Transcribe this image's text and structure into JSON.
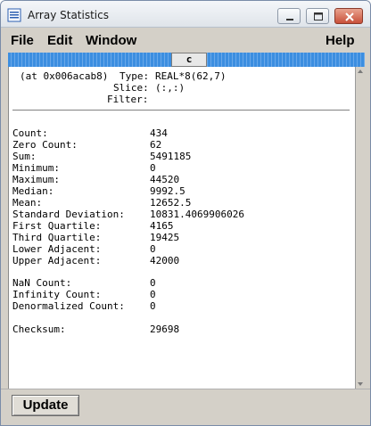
{
  "window": {
    "title": "Array Statistics"
  },
  "menu": {
    "file": "File",
    "edit": "Edit",
    "window": "Window",
    "help": "Help"
  },
  "tab": {
    "label": "c"
  },
  "header": {
    "address": "(at 0x006acab8)",
    "type_label": "Type:",
    "type_value": "REAL*8(62,7)",
    "slice_label": "Slice:",
    "slice_value": "(:,:)",
    "filter_label": "Filter:",
    "filter_value": ""
  },
  "stats": [
    {
      "label": "Count:",
      "value": "434"
    },
    {
      "label": "Zero Count:",
      "value": "62"
    },
    {
      "label": "Sum:",
      "value": "5491185"
    },
    {
      "label": "Minimum:",
      "value": "0"
    },
    {
      "label": "Maximum:",
      "value": "44520"
    },
    {
      "label": "Median:",
      "value": "9992.5"
    },
    {
      "label": "Mean:",
      "value": "12652.5"
    },
    {
      "label": "Standard Deviation:",
      "value": "10831.4069906026"
    },
    {
      "label": "First Quartile:",
      "value": "4165"
    },
    {
      "label": "Third Quartile:",
      "value": "19425"
    },
    {
      "label": "Lower Adjacent:",
      "value": "0"
    },
    {
      "label": "Upper Adjacent:",
      "value": "42000"
    }
  ],
  "special": [
    {
      "label": "NaN Count:",
      "value": "0"
    },
    {
      "label": "Infinity Count:",
      "value": "0"
    },
    {
      "label": "Denormalized Count:",
      "value": "0"
    }
  ],
  "checksum": {
    "label": "Checksum:",
    "value": "29698"
  },
  "footer": {
    "update_label": "Update"
  },
  "colors": {
    "tabstrip": "#3c8ee0",
    "close_button": "#c8503a"
  }
}
